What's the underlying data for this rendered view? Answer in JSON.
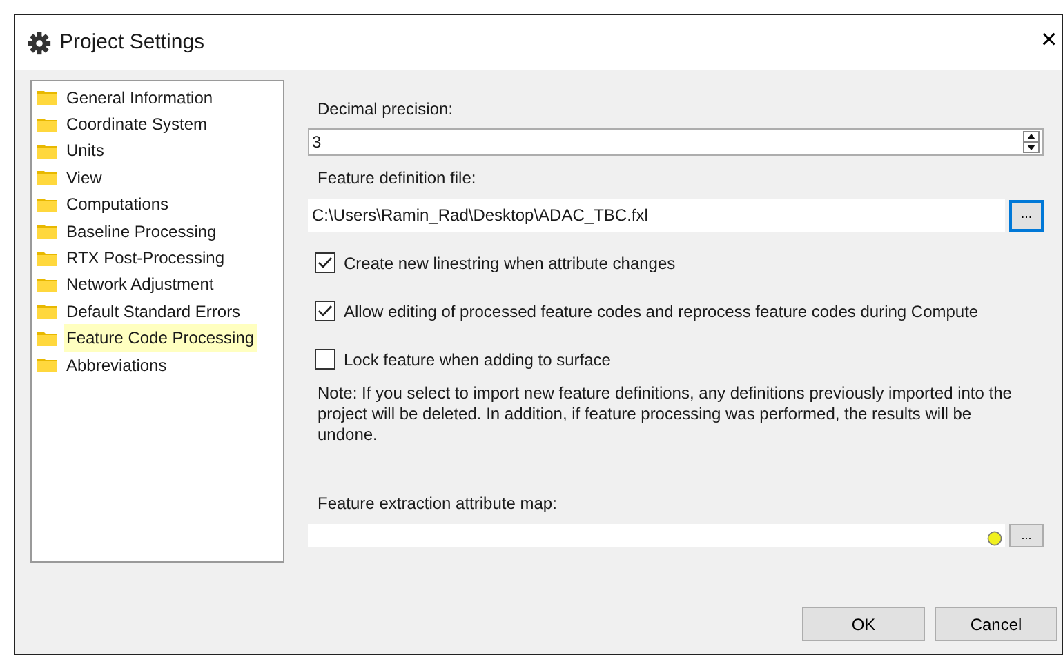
{
  "window": {
    "title": "Project Settings",
    "close": "×"
  },
  "sidebar": {
    "items": [
      {
        "label": "General Information",
        "selected": false
      },
      {
        "label": "Coordinate System",
        "selected": false
      },
      {
        "label": "Units",
        "selected": false
      },
      {
        "label": "View",
        "selected": false
      },
      {
        "label": "Computations",
        "selected": false
      },
      {
        "label": "Baseline Processing",
        "selected": false
      },
      {
        "label": "RTX Post-Processing",
        "selected": false
      },
      {
        "label": "Network Adjustment",
        "selected": false
      },
      {
        "label": "Default Standard Errors",
        "selected": false
      },
      {
        "label": "Feature Code Processing",
        "selected": true
      },
      {
        "label": "Abbreviations",
        "selected": false
      }
    ]
  },
  "decimal_precision": {
    "label": "Decimal precision:",
    "value": "3"
  },
  "feature_definition_file": {
    "label": "Feature definition file:",
    "value": "C:\\Users\\Ramin_Rad\\Desktop\\ADAC_TBC.fxl",
    "browse": "..."
  },
  "checkboxes": [
    {
      "label": "Create new linestring when attribute changes",
      "checked": true
    },
    {
      "label": "Allow editing of processed feature codes and reprocess feature codes during Compute",
      "checked": true
    },
    {
      "label": "Lock feature when adding to surface",
      "checked": false
    }
  ],
  "note": "Note: If you select to import new feature definitions, any definitions previously imported into the project will be deleted. In addition, if feature processing was performed, the results will be undone.",
  "attribute_map": {
    "label": "Feature extraction attribute map:",
    "browse": "..."
  },
  "buttons": [
    "OK",
    "Cancel"
  ]
}
